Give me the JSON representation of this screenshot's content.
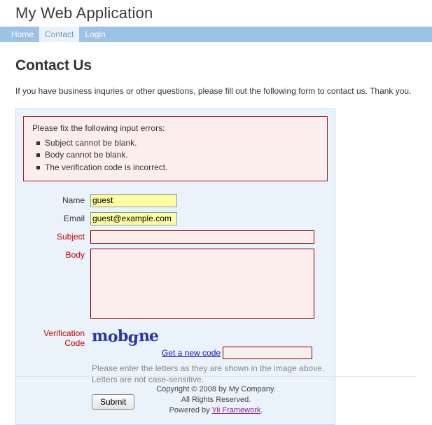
{
  "header": {
    "app_title": "My Web Application"
  },
  "nav": {
    "items": [
      {
        "label": "Home",
        "active": false
      },
      {
        "label": "Contact",
        "active": true
      },
      {
        "label": "Login",
        "active": false
      }
    ]
  },
  "main": {
    "page_title": "Contact Us",
    "intro": "If you have business inquries or other questions, please fill out the following form to contact us. Thank you."
  },
  "error_summary": {
    "title": "Please fix the following input errors:",
    "items": [
      "Subject cannot be blank.",
      "Body cannot be blank.",
      "The verification code is incorrect."
    ]
  },
  "form": {
    "name": {
      "label": "Name",
      "value": "guest",
      "placeholder": ""
    },
    "email": {
      "label": "Email",
      "value": "guest@example.com",
      "placeholder": ""
    },
    "subject": {
      "label": "Subject",
      "value": "",
      "placeholder": ""
    },
    "body": {
      "label": "Body",
      "value": "",
      "placeholder": ""
    },
    "verification": {
      "label_line1": "Verification",
      "label_line2": "Code",
      "captcha_text": "mobgne",
      "new_code_link": "Get a new code",
      "value": "",
      "placeholder": "",
      "hint_line1": "Please enter the letters as they are shown in the image above.",
      "hint_line2": "Letters are not case-sensitive."
    },
    "submit_label": "Submit"
  },
  "footer": {
    "line1": "Copyright © 2008 by My Company.",
    "line2": "All Rights Reserved.",
    "powered_prefix": "Powered by ",
    "powered_link": "Yii Framework",
    "powered_suffix": "."
  },
  "colors": {
    "nav_bar": "#9cc3e5",
    "panel_bg": "#eaf2fa",
    "panel_border": "#c3dcf0",
    "error_border": "#9c1b1b",
    "error_bg": "#fdeeee",
    "error_label": "#cc0000",
    "autofill_yellow": "#ffffa0",
    "link_blue": "#1414c8",
    "link_visited": "#8a1f8a",
    "captcha_blue": "#2a35a8"
  }
}
